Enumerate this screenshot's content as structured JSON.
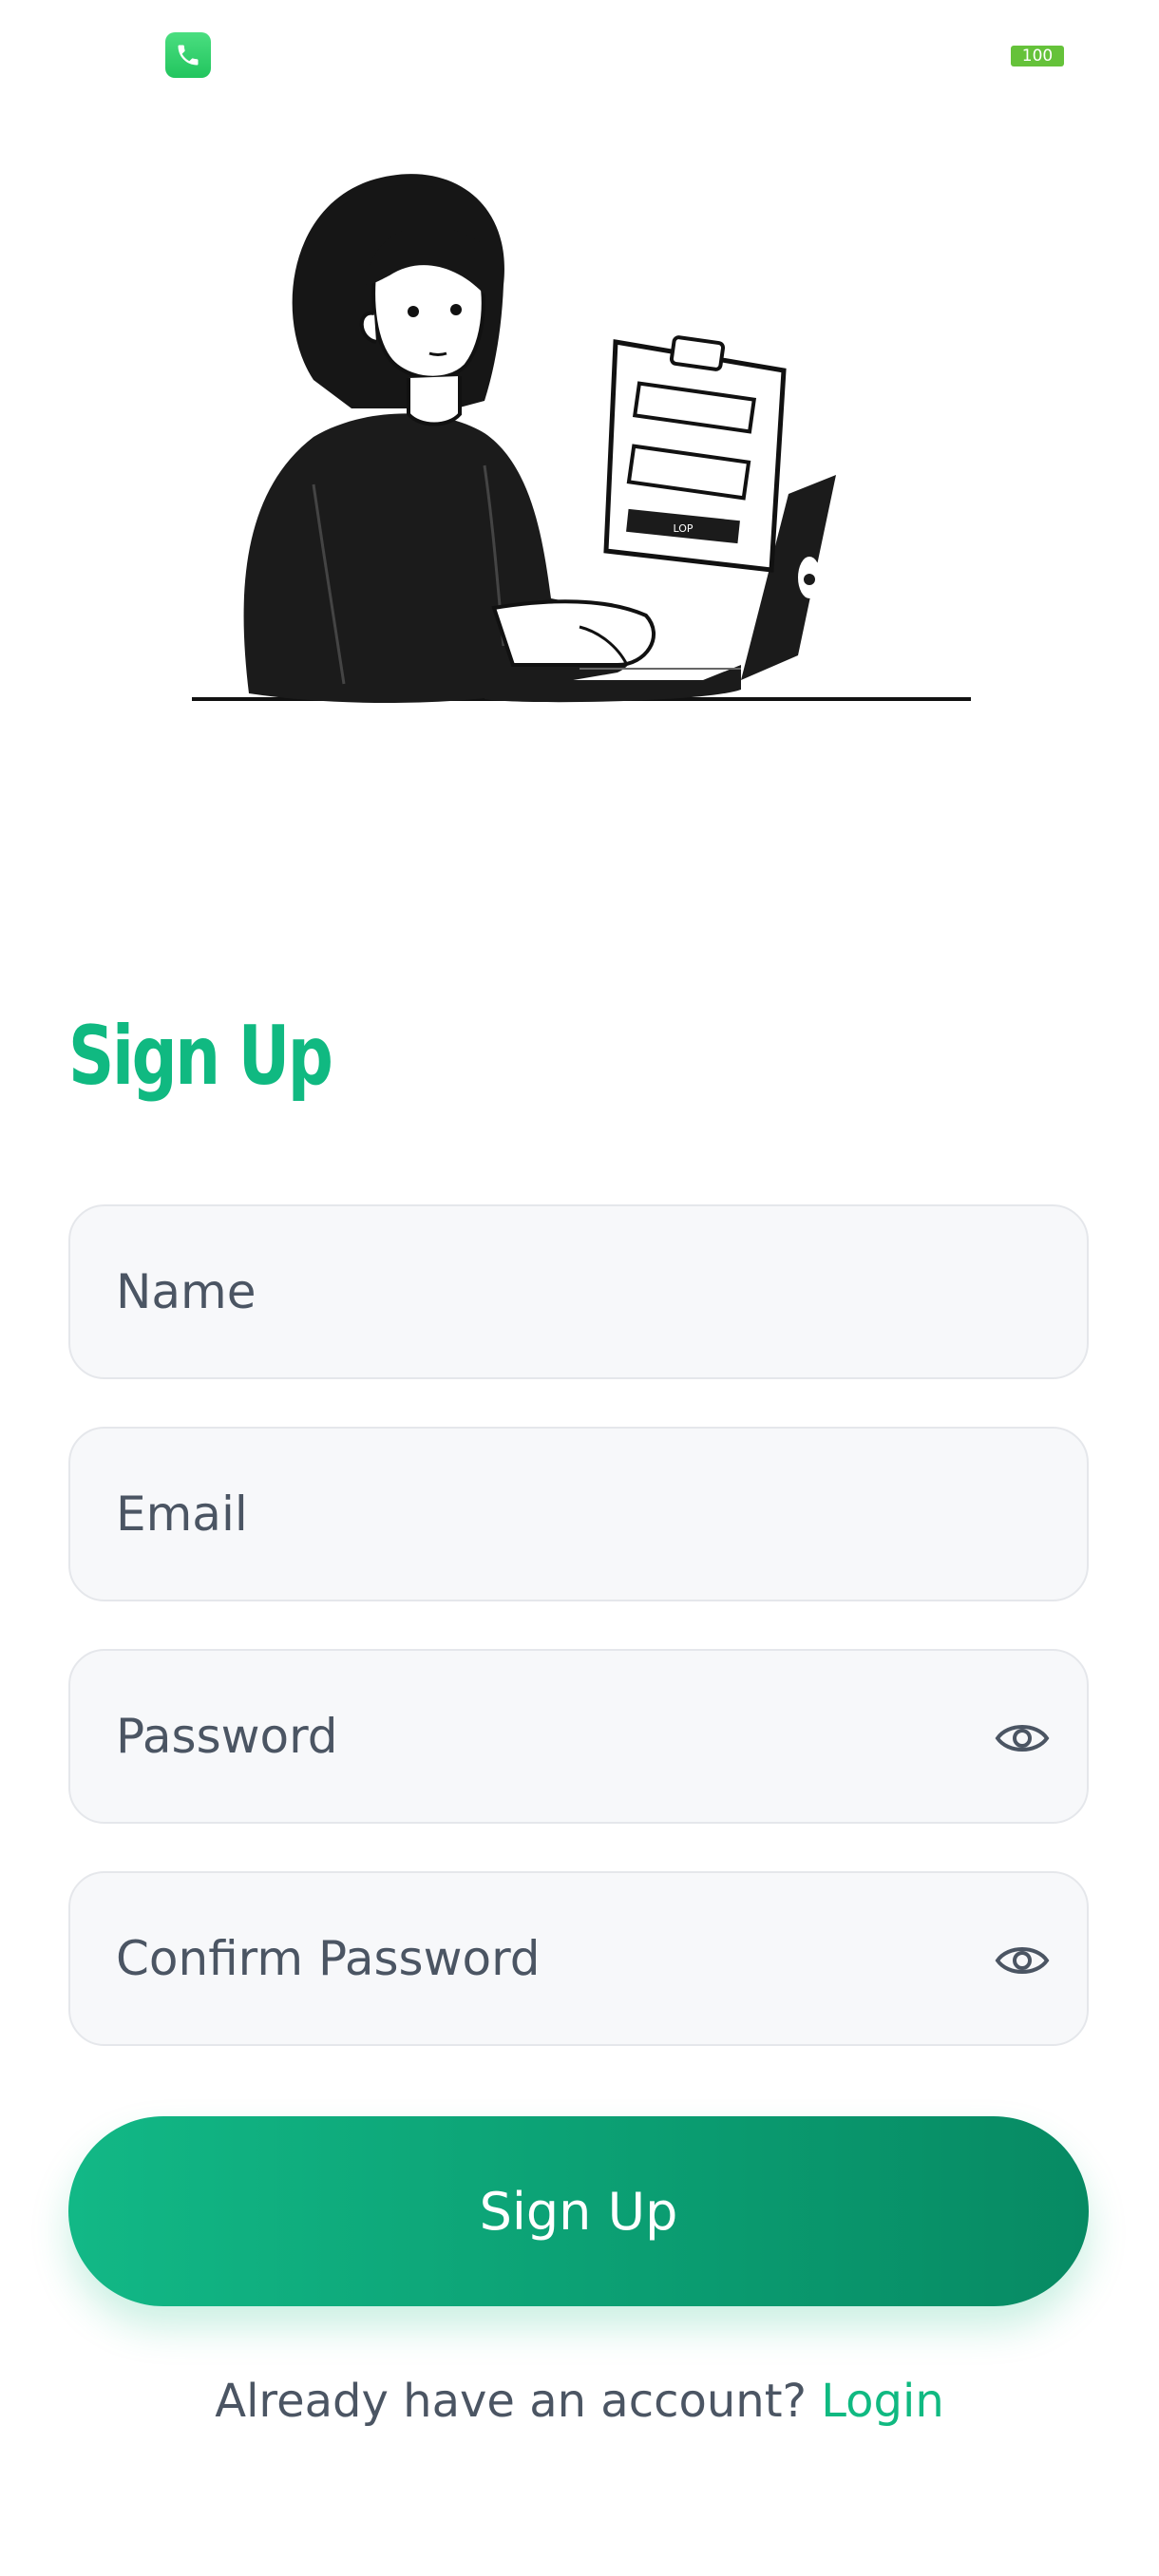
{
  "status_bar": {
    "app_icon": "phone-icon",
    "battery_level": "100",
    "colors": {
      "app_icon": "#22c55e",
      "battery": "#65c23a"
    }
  },
  "illustration": {
    "subject": "woman-typing-on-laptop-with-signup-form-clipboard",
    "clipboard_button": "LOP"
  },
  "form": {
    "title": "Sign Up",
    "fields": {
      "name": {
        "placeholder": "Name"
      },
      "email": {
        "placeholder": "Email"
      },
      "password": {
        "placeholder": "Password",
        "toggle_icon": "eye-icon"
      },
      "confirm_password": {
        "placeholder": "Confirm Password",
        "toggle_icon": "eye-icon"
      }
    },
    "submit_label": "Sign Up"
  },
  "footer": {
    "prompt": "Already have an account?",
    "link": "Login"
  },
  "colors": {
    "accent": "#10b981",
    "button_gradient_start": "#12b886",
    "button_gradient_end": "#078a63",
    "field_background": "#f7f8fa",
    "text": "#4b5563"
  }
}
